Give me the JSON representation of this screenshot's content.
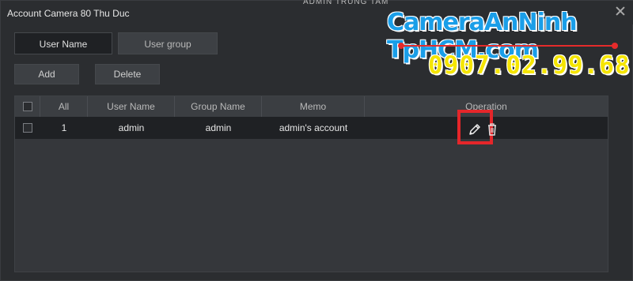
{
  "window": {
    "title": "Account Camera 80 Thu Duc"
  },
  "top_scribble": "ADMIN TRUNG TAM",
  "watermark": {
    "brand": "CameraAnNinh TpHCM.com",
    "phone": "0907.02.99.68"
  },
  "tabs": [
    {
      "label": "User Name",
      "active": true
    },
    {
      "label": "User group",
      "active": false
    }
  ],
  "toolbar": {
    "add_label": "Add",
    "delete_label": "Delete"
  },
  "table": {
    "headers": {
      "all": "All",
      "user_name": "User Name",
      "group_name": "Group Name",
      "memo": "Memo",
      "operation": "Operation"
    },
    "rows": [
      {
        "index": "1",
        "user_name": "admin",
        "group_name": "admin",
        "memo": "admin's account"
      }
    ]
  },
  "icons": {
    "edit": "pencil-icon",
    "delete": "trash-icon",
    "close": "close-icon"
  },
  "colors": {
    "highlight": "#e5262a",
    "brand_blue": "#1a9ee8",
    "phone_yellow": "#f5e500"
  }
}
